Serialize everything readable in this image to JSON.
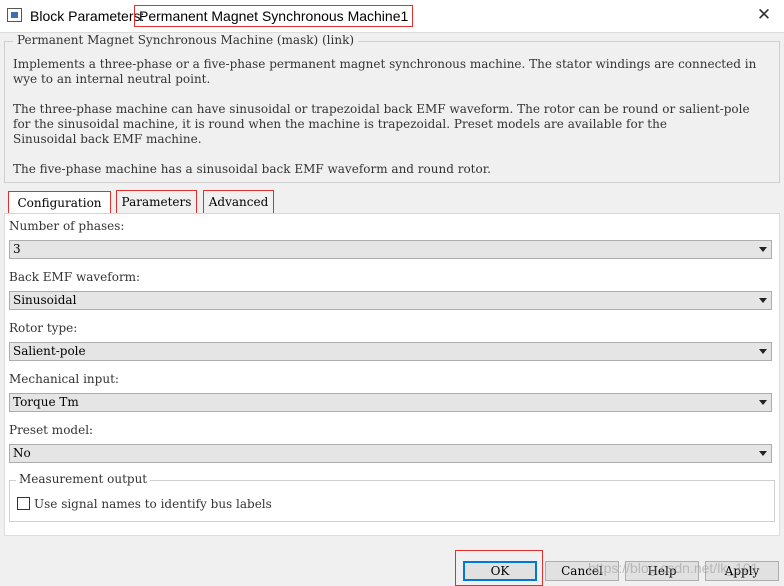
{
  "window": {
    "title_prefix": "Block Parameters:",
    "block_name": "Permanent Magnet Synchronous Machine1",
    "close_glyph": "✕"
  },
  "description": {
    "legend": "Permanent Magnet Synchronous Machine (mask) (link)",
    "para1_line1": "Implements a three-phase or a five-phase permanent magnet synchronous machine. The stator windings are connected in",
    "para1_line2": "wye to an internal neutral point.",
    "para2_line1": "The three-phase machine can have sinusoidal or trapezoidal back EMF waveform. The rotor can be round or salient-pole",
    "para2_line2": "for the sinusoidal machine, it is round when the machine is trapezoidal. Preset models are available for the",
    "para2_line3": "Sinusoidal back EMF machine.",
    "para3_line1": "The five-phase machine has a sinusoidal back EMF waveform and round rotor."
  },
  "tabs": [
    {
      "label": "Configuration",
      "active": true
    },
    {
      "label": "Parameters",
      "active": false
    },
    {
      "label": "Advanced",
      "active": false
    }
  ],
  "config": {
    "phases": {
      "label": "Number of phases:",
      "value": "3"
    },
    "emf": {
      "label": "Back EMF waveform:",
      "value": "Sinusoidal"
    },
    "rotor": {
      "label": "Rotor type:",
      "value": "Salient-pole"
    },
    "mech": {
      "label": "Mechanical input:",
      "value": "Torque Tm"
    },
    "preset": {
      "label": "Preset model:",
      "value": "No"
    }
  },
  "measurement": {
    "legend": "Measurement output",
    "checkbox_label": "Use signal names to identify bus labels",
    "checked": false
  },
  "buttons": {
    "ok": "OK",
    "cancel": "Cancel",
    "help": "Help",
    "apply": "Apply"
  },
  "watermark": "https://blog.csdn.net/lk_101",
  "colors": {
    "highlight": "#e03030",
    "focus": "#0078d7"
  },
  "icons": {
    "window": "block-parameters-icon",
    "dropdown": "chevron-down-icon",
    "close": "close-icon"
  }
}
